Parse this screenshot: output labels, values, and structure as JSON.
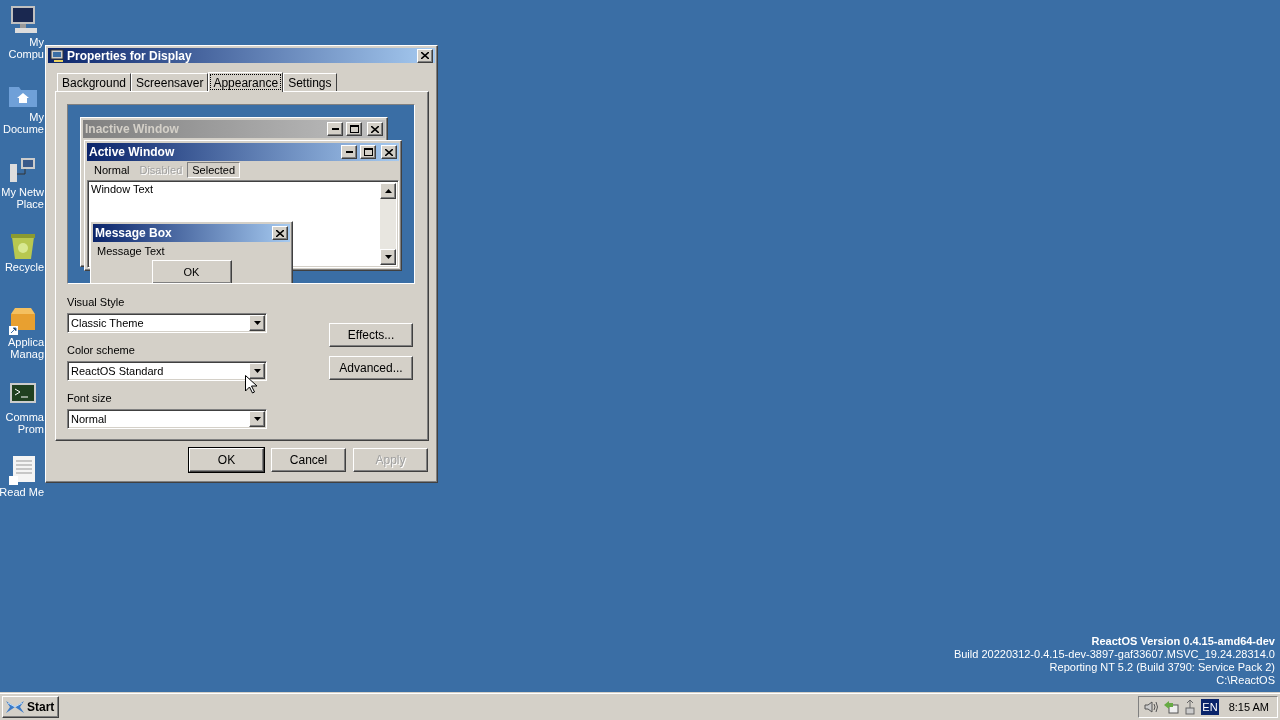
{
  "desktop_icons": [
    {
      "kind": "computer",
      "lines": [
        "My",
        "Compu"
      ]
    },
    {
      "kind": "folder",
      "lines": [
        "My",
        "Docume"
      ]
    },
    {
      "kind": "network",
      "lines": [
        "My Netw",
        "Place"
      ]
    },
    {
      "kind": "recycle",
      "lines": [
        "Recycle"
      ]
    },
    {
      "kind": "package",
      "lines": [
        "Applica",
        "Manag"
      ]
    },
    {
      "kind": "terminal",
      "lines": [
        "Comma",
        "Prom"
      ]
    },
    {
      "kind": "document",
      "lines": [
        "Read Me"
      ]
    }
  ],
  "dialog": {
    "title": "Properties for Display",
    "tabs": [
      {
        "label": "Background",
        "selected": false
      },
      {
        "label": "Screensaver",
        "selected": false
      },
      {
        "label": "Appearance",
        "selected": true
      },
      {
        "label": "Settings",
        "selected": false
      }
    ],
    "preview": {
      "inactive_title": "Inactive Window",
      "active_title": "Active Window",
      "menu": [
        {
          "label": "Normal",
          "disabled": false,
          "selected": false
        },
        {
          "label": "Disabled",
          "disabled": true,
          "selected": false
        },
        {
          "label": "Selected",
          "disabled": false,
          "selected": true
        }
      ],
      "window_text": "Window Text",
      "message_title": "Message Box",
      "message_text": "Message Text",
      "message_button": "OK"
    },
    "fields": [
      {
        "label": "Visual Style",
        "value": "Classic Theme"
      },
      {
        "label": "Color scheme",
        "value": "ReactOS Standard"
      },
      {
        "label": "Font size",
        "value": "Normal"
      }
    ],
    "side_buttons": [
      "Effects...",
      "Advanced..."
    ],
    "buttons": [
      {
        "label": "OK",
        "disabled": false,
        "default": true
      },
      {
        "label": "Cancel",
        "disabled": false,
        "default": false
      },
      {
        "label": "Apply",
        "disabled": true,
        "default": false
      }
    ]
  },
  "version_info": [
    {
      "text": "ReactOS Version 0.4.15-amd64-dev",
      "kind": "heading"
    },
    {
      "text": "Build 20220312-0.4.15-dev-3897-gaf33607.MSVC_19.24.28314.0",
      "kind": "line"
    },
    {
      "text": "Reporting NT 5.2 (Build 3790: Service Pack 2)",
      "kind": "line"
    },
    {
      "text": "C:\\ReactOS",
      "kind": "line"
    }
  ],
  "taskbar": {
    "start": "Start",
    "language": "EN",
    "clock": "8:15 AM"
  }
}
